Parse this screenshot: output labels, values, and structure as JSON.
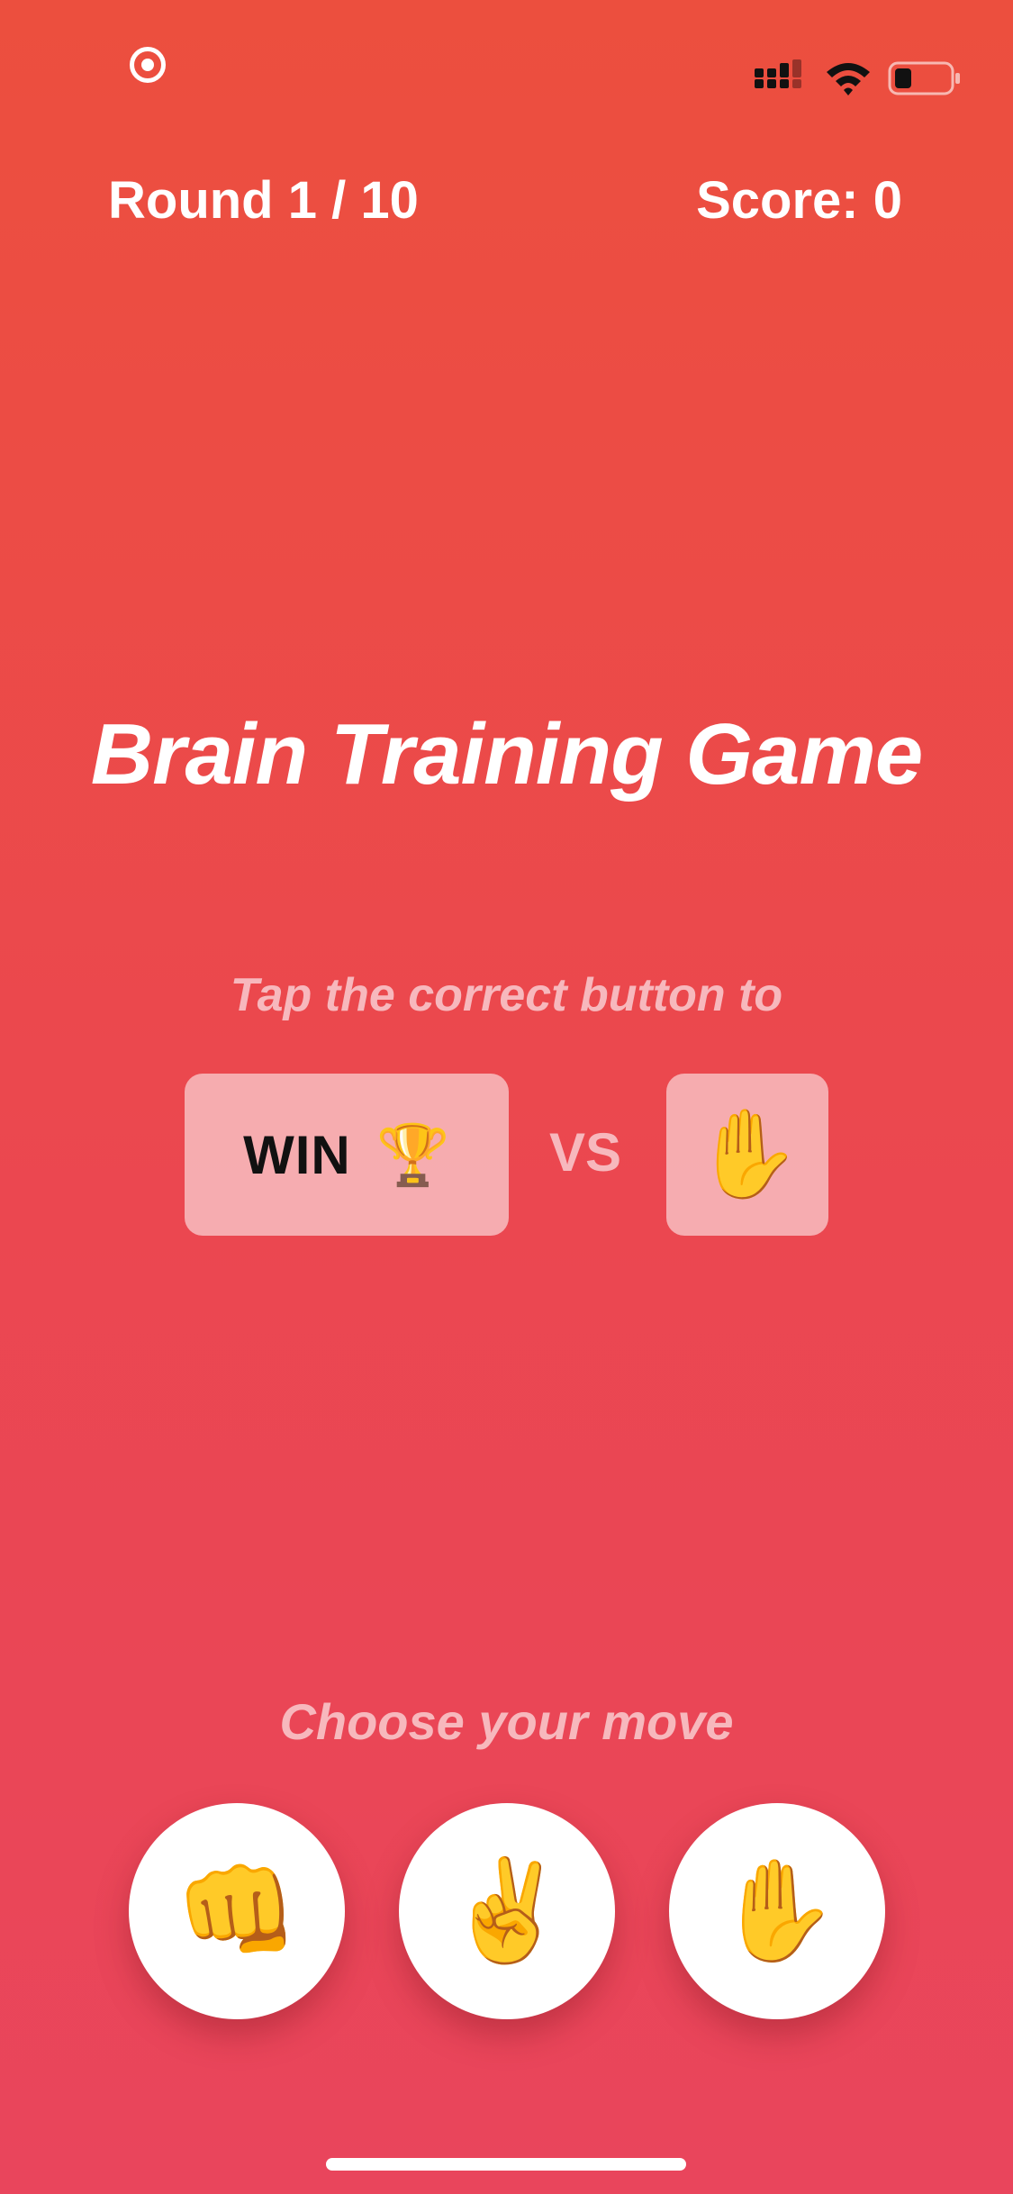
{
  "header": {
    "round": "Round 1 / 10",
    "score": "Score: 0"
  },
  "title": "Brain Training Game",
  "prompt": "Tap the correct button to",
  "goal": {
    "label": "WIN",
    "icon": "trophy-icon",
    "emoji": "🏆"
  },
  "vs_label": "VS",
  "opponent": {
    "icon": "paper-hand-icon",
    "emoji": "✋"
  },
  "choose_label": "Choose your move",
  "moves": [
    {
      "name": "rock",
      "icon": "fist-icon",
      "emoji": "👊"
    },
    {
      "name": "scissors",
      "icon": "victory-hand-icon",
      "emoji": "✌️"
    },
    {
      "name": "paper",
      "icon": "raised-hand-icon",
      "emoji": "✋"
    }
  ],
  "colors": {
    "background_top": "#ec4f3e",
    "background_bottom": "#e9455c",
    "muted_text": "#f7b8bd",
    "text": "#ffffff"
  }
}
